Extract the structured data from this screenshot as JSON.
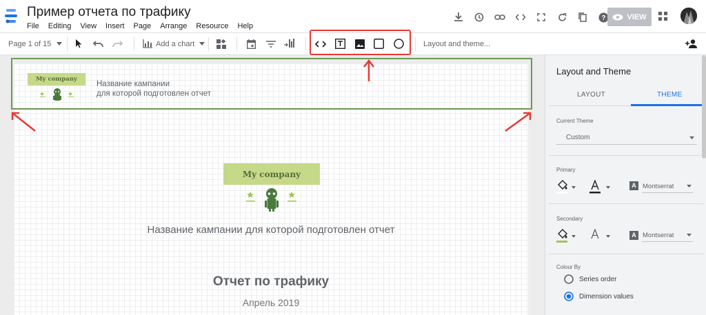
{
  "app": {
    "title": "Пример отчета по трафику",
    "menu": [
      "File",
      "Editing",
      "View",
      "Insert",
      "Page",
      "Arrange",
      "Resource",
      "Help"
    ],
    "view_label": "VIEW",
    "colors": {
      "accent": "#1a73e8",
      "highlight": "#e53935",
      "selection": "#6a9a55",
      "logo_bg": "#c5d989"
    }
  },
  "toolbar": {
    "page_indicator": "Page 1 of 15",
    "add_chart": "Add a chart",
    "layout_theme": "Layout and theme..."
  },
  "report": {
    "header_logo": "My company",
    "header_line1": "Название кампании",
    "header_line2": "для которой подготовлен отчет",
    "main_logo": "My company",
    "campaign": "Название кампании для которой подготовлен отчет",
    "report_title": "Отчет по трафику",
    "report_date": "Апрель 2019"
  },
  "panel": {
    "title": "Layout and Theme",
    "tab_layout": "LAYOUT",
    "tab_theme": "THEME",
    "current_theme_label": "Current Theme",
    "current_theme_value": "Custom",
    "primary_label": "Primary",
    "primary_font": "Montserrat",
    "secondary_label": "Secondary",
    "secondary_font": "Montserrat",
    "colour_by_label": "Colour By",
    "option_series": "Series order",
    "option_dimension": "Dimension values",
    "selected_option": "Dimension values",
    "font_icon_letter": "A"
  }
}
